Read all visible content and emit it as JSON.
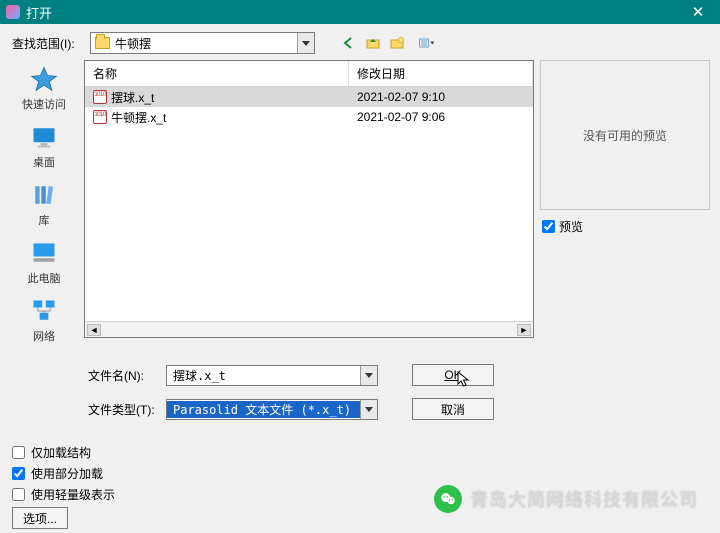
{
  "titlebar": {
    "title": "打开"
  },
  "lookin": {
    "label": "查找范围(I):",
    "folder": "牛顿摆"
  },
  "places": {
    "quick": "快速访问",
    "desktop": "桌面",
    "libs": "库",
    "thispc": "此电脑",
    "network": "网络"
  },
  "filelist": {
    "col_name": "名称",
    "col_date": "修改日期",
    "rows": [
      {
        "name": "摆球.x_t",
        "date": "2021-02-07 9:10",
        "selected": true
      },
      {
        "name": "牛顿摆.x_t",
        "date": "2021-02-07 9:06",
        "selected": false
      }
    ]
  },
  "preview": {
    "empty_text": "没有可用的预览",
    "checkbox_label": "预览",
    "checked": true
  },
  "fields": {
    "filename_label": "文件名(N):",
    "filename_value": "摆球.x_t",
    "filetype_label": "文件类型(T):",
    "filetype_value": "Parasolid 文本文件 (*.x_t)"
  },
  "buttons": {
    "ok": "OK",
    "cancel": "取消"
  },
  "options": {
    "only_load_struct": "仅加载结构",
    "partial_load": "使用部分加载",
    "lightweight": "使用轻量级表示",
    "partial_load_checked": true,
    "options_btn": "选项..."
  },
  "watermark": {
    "text": "青岛大简网络科技有限公司"
  }
}
